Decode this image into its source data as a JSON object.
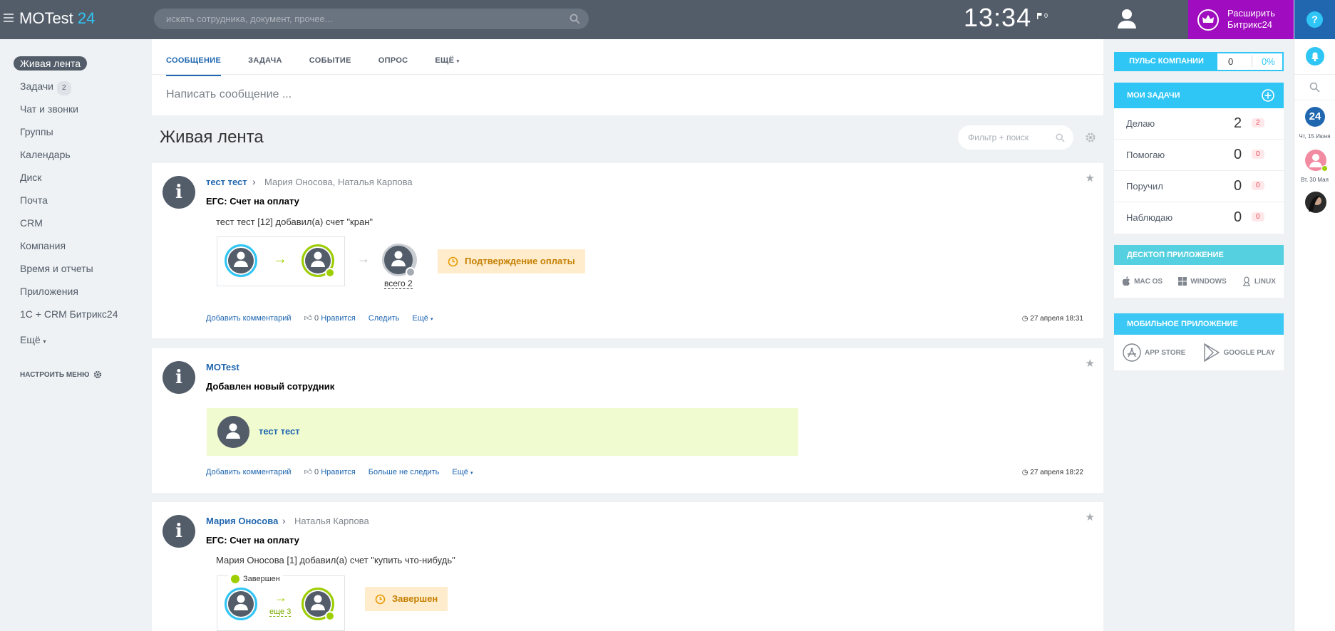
{
  "header": {
    "logo_main": "MOTest",
    "logo_num": "24",
    "search_placeholder": "искать сотрудника, документ, прочее...",
    "time": "13:34",
    "flags": "0",
    "upgrade_line1": "Расширить",
    "upgrade_line2": "Битрикс24",
    "help": "?"
  },
  "menu": {
    "items": [
      {
        "label": "Живая лента"
      },
      {
        "label": "Задачи",
        "count": "2"
      },
      {
        "label": "Чат и звонки"
      },
      {
        "label": "Группы"
      },
      {
        "label": "Календарь"
      },
      {
        "label": "Диск"
      },
      {
        "label": "Почта"
      },
      {
        "label": "CRM"
      },
      {
        "label": "Компания"
      },
      {
        "label": "Время и отчеты"
      },
      {
        "label": "Приложения"
      },
      {
        "label": "1С + CRM Битрикс24"
      },
      {
        "label": "Ещё"
      }
    ],
    "settings": "НАСТРОИТЬ МЕНЮ"
  },
  "composer": {
    "tabs": [
      "СООБЩЕНИЕ",
      "ЗАДАЧА",
      "СОБЫТИЕ",
      "ОПРОС",
      "ЕЩЁ"
    ],
    "placeholder": "Написать сообщение ..."
  },
  "feed": {
    "title": "Живая лента",
    "filter_placeholder": "Фильтр + поиск"
  },
  "posts": [
    {
      "author": "тест тест",
      "recipients": "Мария Оносова, Наталья Карпова",
      "title": "ЕГС: Счет на оплату",
      "text": "тест тест [12] добавил(а) счет \"кран\"",
      "total": "всего 2",
      "status": "Подтверждение оплаты",
      "actions": [
        "Добавить комментарий",
        "Нравится",
        "Следить",
        "Ещё"
      ],
      "likes": "0",
      "date": "27 апреля 18:31"
    },
    {
      "author": "MOTest",
      "title": "Добавлен новый сотрудник",
      "employee": "тест тест",
      "actions": [
        "Добавить комментарий",
        "Нравится",
        "Больше не следить",
        "Ещё"
      ],
      "likes": "0",
      "date": "27 апреля 18:22"
    },
    {
      "author": "Мария Оносова",
      "recipients": "Наталья Карпова",
      "title": "ЕГС: Счет на оплату",
      "text": "Мария Оносова [1] добавил(а) счет \"купить что-нибудь\"",
      "done_label": "Завершен",
      "more": "еще 3",
      "status": "Завершен"
    }
  ],
  "right": {
    "pulse": {
      "label": "ПУЛЬС КОМПАНИИ",
      "value": "0",
      "percent": "0%"
    },
    "tasks": {
      "title": "МОИ ЗАДАЧИ",
      "rows": [
        {
          "label": "Делаю",
          "value": "2",
          "badge": "2"
        },
        {
          "label": "Помогаю",
          "value": "0",
          "badge": "0"
        },
        {
          "label": "Поручил",
          "value": "0",
          "badge": "0"
        },
        {
          "label": "Наблюдаю",
          "value": "0",
          "badge": "0"
        }
      ]
    },
    "desktop": {
      "title": "ДЕСКТОП ПРИЛОЖЕНИЕ",
      "items": [
        "MAC OS",
        "WINDOWS",
        "LINUX"
      ]
    },
    "mobile": {
      "title": "МОБИЛЬНОЕ ПРИЛОЖЕНИЕ",
      "items": [
        "APP STORE",
        "GOOGLE PLAY"
      ]
    }
  },
  "rightbar": {
    "date1": "Чт, 15 Июня",
    "date2": "Вт, 30 Мая",
    "cal_num": "24"
  },
  "colors": {
    "header": "#535c69",
    "accent": "#2fc6f6",
    "link": "#2067b0",
    "upgrade": "#a00cbf"
  }
}
